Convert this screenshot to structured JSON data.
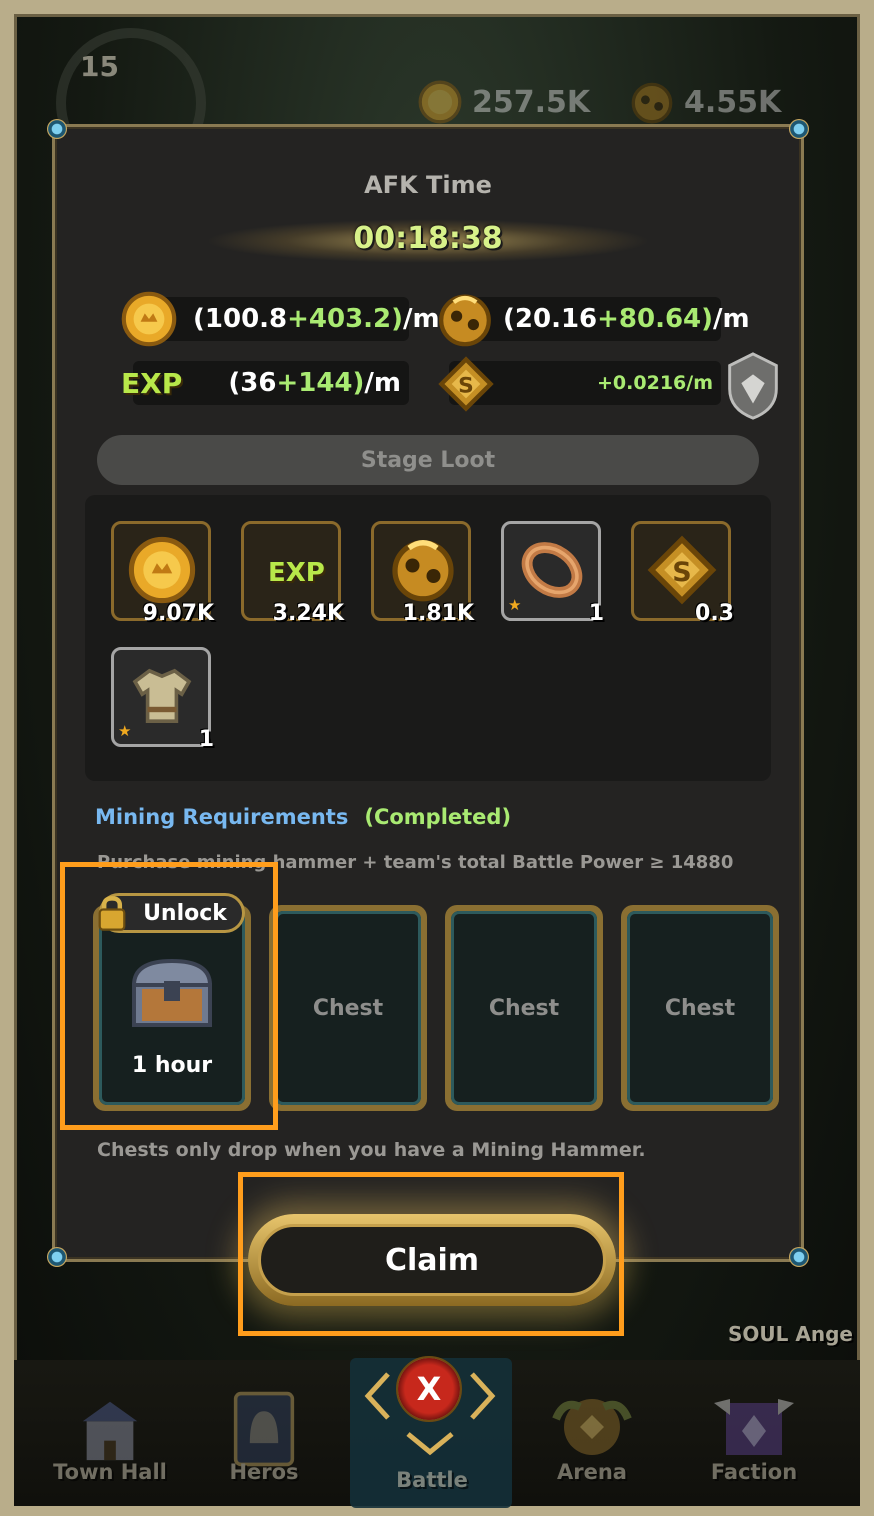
{
  "hud": {
    "level": "15",
    "gold": "257.5K",
    "ore": "4.55K"
  },
  "dialog": {
    "title": "AFK Time",
    "timer": "00:18:38",
    "rates": {
      "gold_base": "(100.8",
      "gold_bonus": "+403.2)",
      "gold_unit": "/m",
      "ore_base": "(20.16",
      "ore_bonus": "+80.64)",
      "ore_unit": "/m",
      "exp_label": "EXP",
      "exp_base": "(36",
      "exp_bonus": "+144)",
      "exp_unit": "/m",
      "soul_rate": "+0.0216/m"
    },
    "stage_loot_label": "Stage Loot",
    "loot": [
      {
        "icon": "gold-coin-icon",
        "qty": "9.07K"
      },
      {
        "icon": "exp-icon",
        "qty": "3.24K",
        "label": "EXP"
      },
      {
        "icon": "ore-icon",
        "qty": "1.81K"
      },
      {
        "icon": "ring-icon",
        "qty": "1"
      },
      {
        "icon": "soul-gem-icon",
        "qty": "0.3"
      },
      {
        "icon": "armor-shirt-icon",
        "qty": "1"
      }
    ],
    "mining": {
      "label": "Mining Requirements",
      "status": "(Completed)",
      "description": "Purchase mining hammer + team's total Battle Power ≥ 14880"
    },
    "chests": {
      "unlock_label": "Unlock",
      "unlock_time": "1 hour",
      "slots": [
        "Chest",
        "Chest",
        "Chest"
      ]
    },
    "note": "Chests only drop when you have a Mining Hammer.",
    "claim_label": "Claim"
  },
  "side_character": "SOUL Ange",
  "nav": {
    "items": [
      "Town Hall",
      "Heros",
      "Battle",
      "Arena",
      "Faction"
    ],
    "close_label": "X"
  },
  "colors": {
    "highlight": "#ff9d1c",
    "bonus_green": "#a9ea72",
    "link_blue": "#78b8f0",
    "gold_border": "#8b6a2b"
  }
}
